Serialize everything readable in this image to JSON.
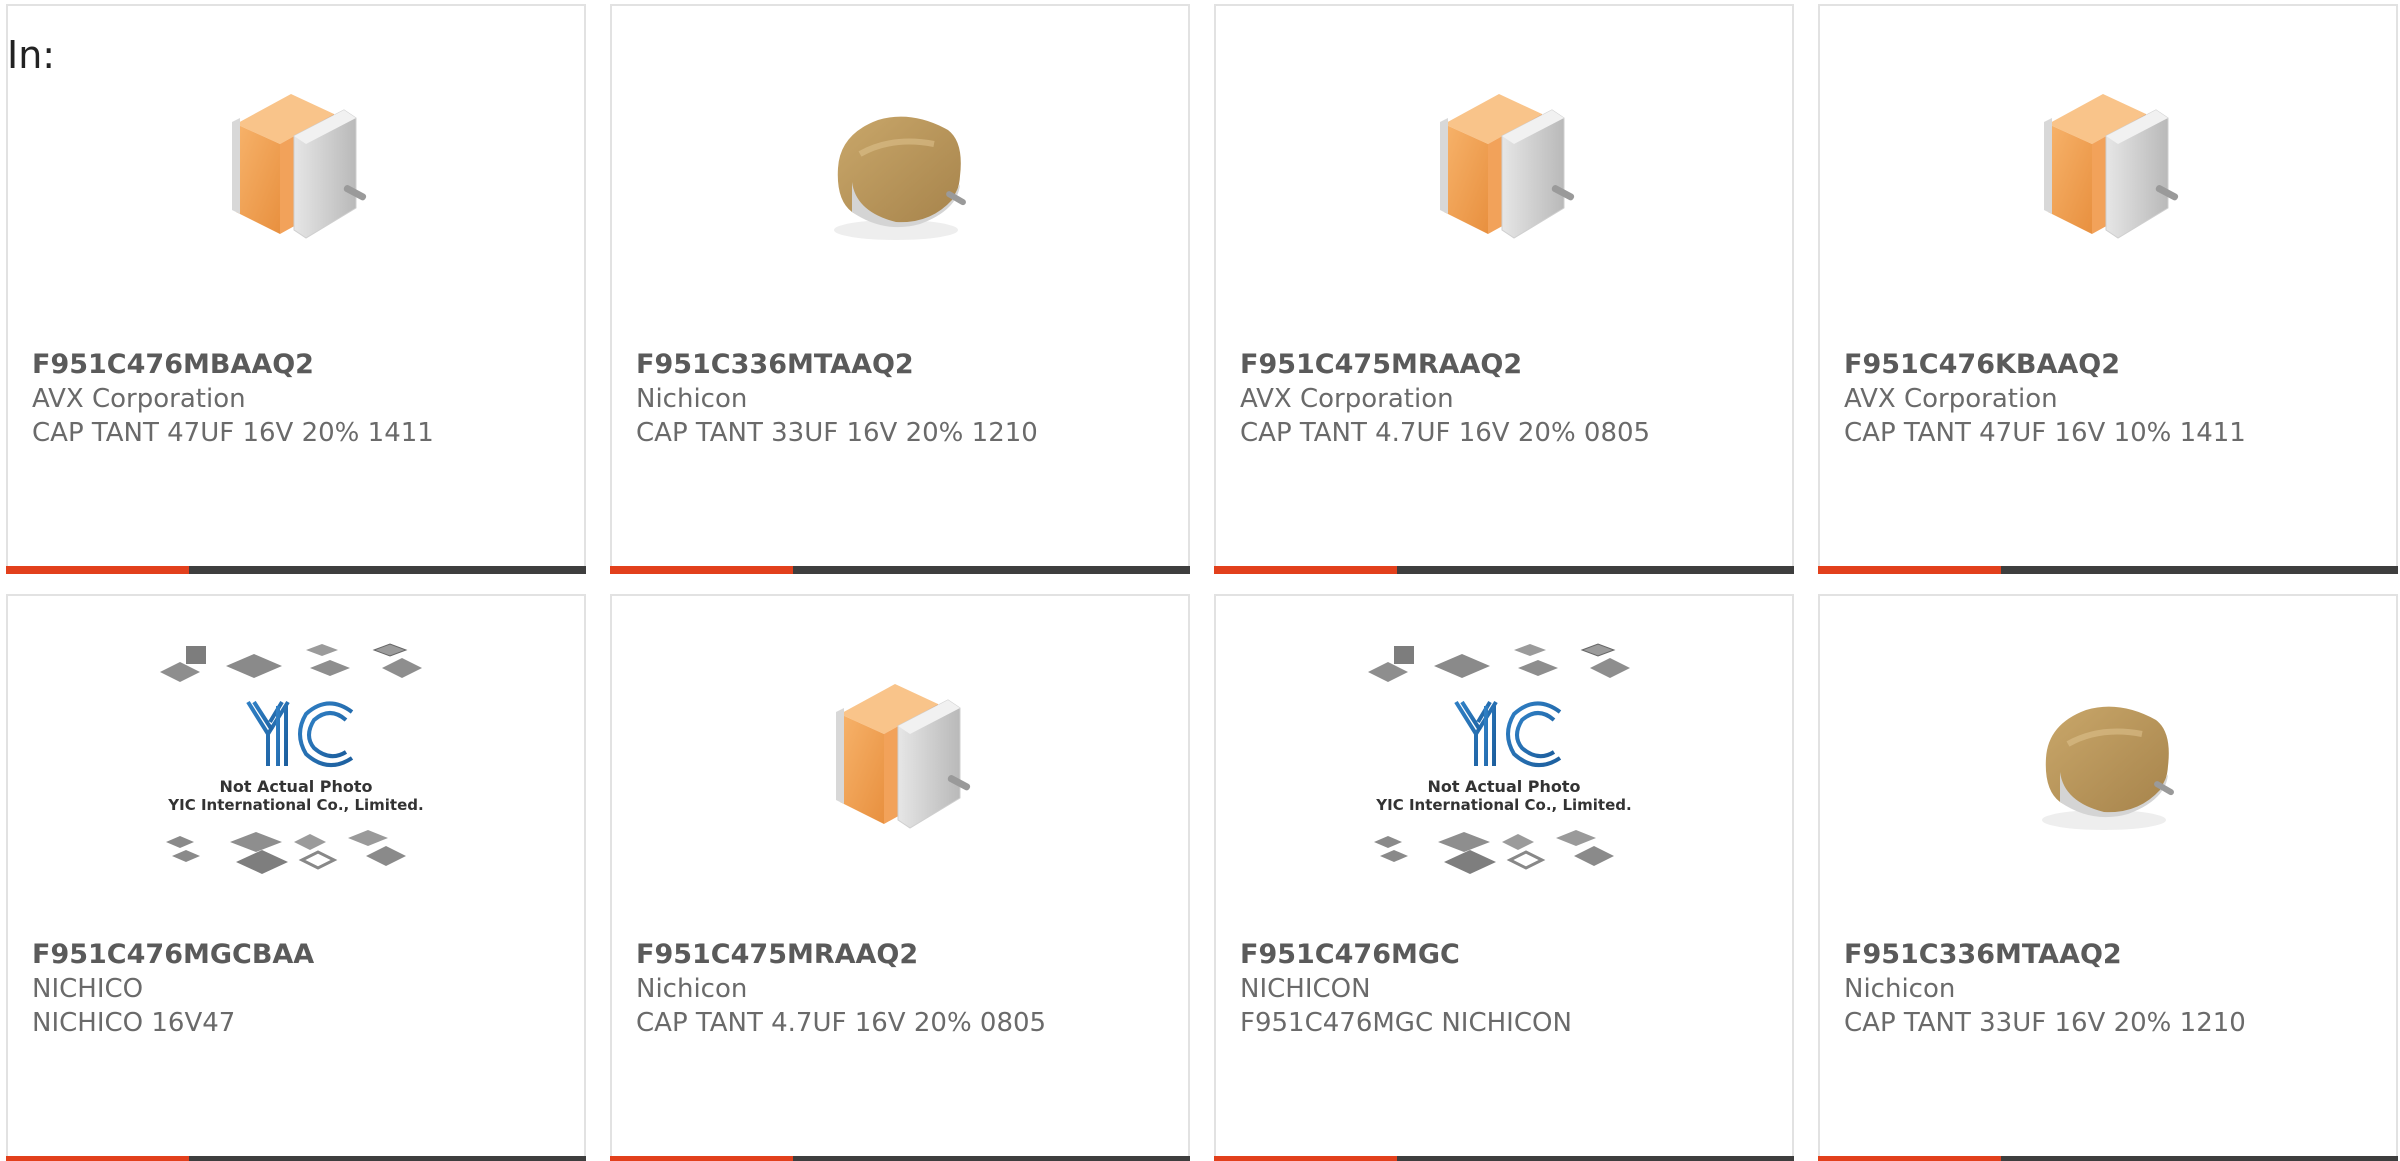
{
  "header": {
    "in_label": "In:"
  },
  "colors": {
    "accent_bar": "#e2401c",
    "bar_dark": "#3e3e3e",
    "card_border": "#e2e2e2",
    "tantalum_orange": "#f2a25a",
    "tantalum_brown": "#b8955a"
  },
  "products": [
    {
      "image": "orange-chip-capacitor",
      "part_number": "F951C476MBAAQ2",
      "manufacturer": "AVX Corporation",
      "description": "CAP TANT 47UF 16V 20% 1411"
    },
    {
      "image": "molded-tantalum-capacitor",
      "part_number": "F951C336MTAAQ2",
      "manufacturer": "Nichicon",
      "description": "CAP TANT 33UF 16V 20% 1210"
    },
    {
      "image": "orange-chip-capacitor",
      "part_number": "F951C475MRAAQ2",
      "manufacturer": "AVX Corporation",
      "description": "CAP TANT 4.7UF 16V 20% 0805"
    },
    {
      "image": "orange-chip-capacitor",
      "part_number": "F951C476KBAAQ2",
      "manufacturer": "AVX Corporation",
      "description": "CAP TANT 47UF 16V 10% 1411"
    },
    {
      "image": "yic-placeholder",
      "placeholder_line1": "Not Actual Photo",
      "placeholder_line2": "YIC International Co., Limited.",
      "part_number": "F951C476MGCBAA",
      "manufacturer": "NICHICO",
      "description": "NICHICO 16V47"
    },
    {
      "image": "orange-chip-capacitor",
      "part_number": "F951C475MRAAQ2",
      "manufacturer": "Nichicon",
      "description": "CAP TANT 4.7UF 16V 20% 0805"
    },
    {
      "image": "yic-placeholder",
      "placeholder_line1": "Not Actual Photo",
      "placeholder_line2": "YIC International Co., Limited.",
      "part_number": "F951C476MGC",
      "manufacturer": "NICHICON",
      "description": "F951C476MGC NICHICON"
    },
    {
      "image": "molded-tantalum-capacitor",
      "part_number": "F951C336MTAAQ2",
      "manufacturer": "Nichicon",
      "description": "CAP TANT 33UF 16V 20% 1210"
    }
  ]
}
